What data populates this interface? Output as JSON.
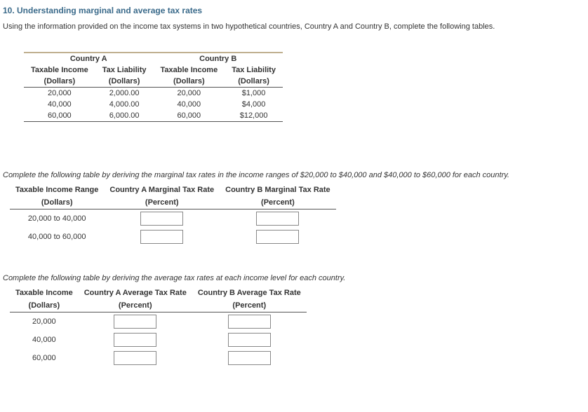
{
  "title": "10. Understanding marginal and average tax rates",
  "intro": "Using the information provided on the income tax systems in two hypothetical countries, Country A and Country B, complete the following tables.",
  "taxTable": {
    "groupA": "Country A",
    "groupB": "Country B",
    "colIncome": "Taxable Income",
    "colLiab": "Tax Liability",
    "unitDollars": "(Dollars)",
    "rows": [
      {
        "aInc": "20,000",
        "aLiab": "2,000.00",
        "bInc": "20,000",
        "bLiab": "$1,000"
      },
      {
        "aInc": "40,000",
        "aLiab": "4,000.00",
        "bInc": "40,000",
        "bLiab": "$4,000"
      },
      {
        "aInc": "60,000",
        "aLiab": "6,000.00",
        "bInc": "60,000",
        "bLiab": "$12,000"
      }
    ]
  },
  "marginal": {
    "instruction": "Complete the following table by deriving the marginal tax rates in the income ranges of $20,000 to $40,000 and $40,000 to $60,000 for each country.",
    "colRange": "Taxable Income Range",
    "colA": "Country A Marginal Tax Rate",
    "colB": "Country B Marginal Tax Rate",
    "unitDollars": "(Dollars)",
    "unitPercent": "(Percent)",
    "rows": [
      {
        "range": "20,000 to 40,000"
      },
      {
        "range": "40,000 to 60,000"
      }
    ]
  },
  "average": {
    "instruction": "Complete the following table by deriving the average tax rates at each income level for each country.",
    "colIncome": "Taxable Income",
    "colA": "Country A Average Tax Rate",
    "colB": "Country B Average Tax Rate",
    "unitDollars": "(Dollars)",
    "unitPercent": "(Percent)",
    "rows": [
      {
        "income": "20,000"
      },
      {
        "income": "40,000"
      },
      {
        "income": "60,000"
      }
    ]
  }
}
